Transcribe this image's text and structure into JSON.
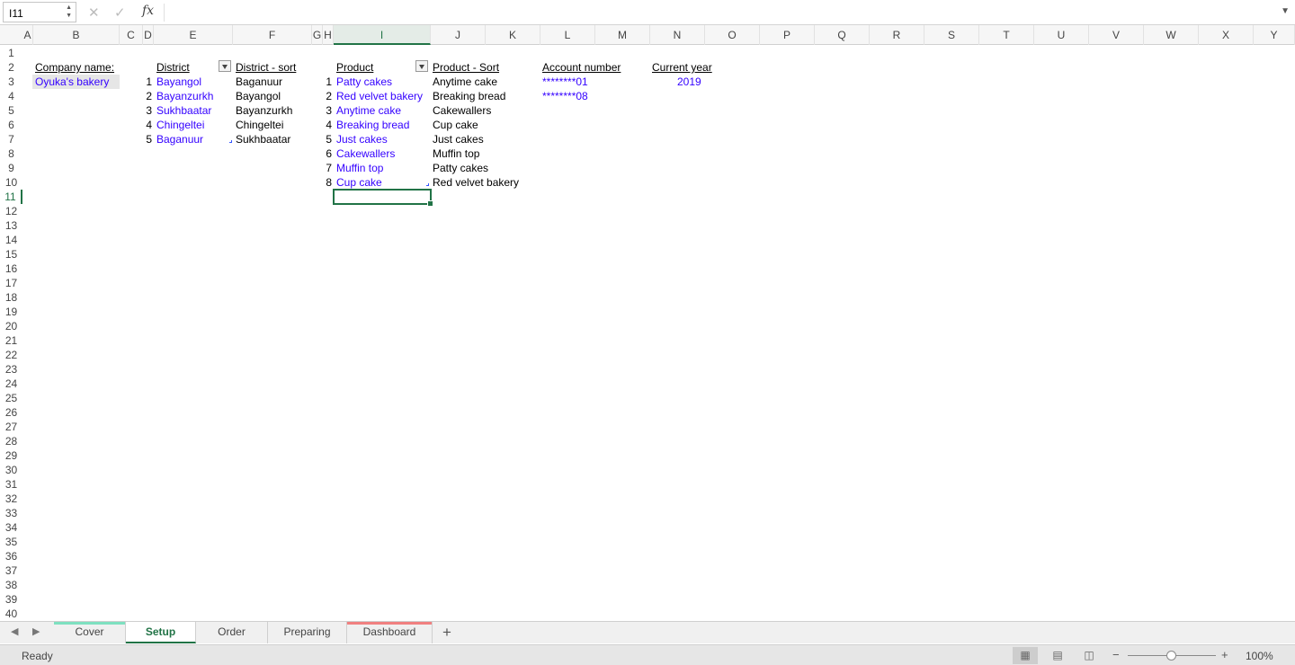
{
  "formula_bar": {
    "name_box": "I11",
    "cancel_icon": "close-icon",
    "enter_icon": "check-icon",
    "fx_label": "fx",
    "formula": ""
  },
  "columns": [
    "A",
    "B",
    "C",
    "D",
    "E",
    "F",
    "G",
    "H",
    "I",
    "J",
    "K",
    "L",
    "M",
    "N",
    "O",
    "P",
    "Q",
    "R",
    "S",
    "T",
    "U",
    "V",
    "W",
    "X",
    "Y"
  ],
  "selected_column": "I",
  "selected_row": "11",
  "rows": [
    "1",
    "2",
    "3",
    "4",
    "5",
    "6",
    "7",
    "8",
    "9",
    "10",
    "11",
    "12",
    "13",
    "14",
    "15",
    "16",
    "17",
    "18",
    "19",
    "20",
    "21",
    "22",
    "23",
    "24",
    "25",
    "26",
    "27",
    "28",
    "29",
    "30",
    "31",
    "32",
    "33",
    "34",
    "35",
    "36",
    "37",
    "38",
    "39",
    "40"
  ],
  "sheet": {
    "company_label": "Company name:",
    "company_name": "Oyuka's bakery",
    "district_header": "District",
    "district_sort_header": "District - sort",
    "product_header": "Product",
    "product_sort_header": "Product - Sort",
    "account_header": "Account number",
    "year_header": "Current year",
    "current_year": "2019",
    "accounts": [
      "********01",
      "********08"
    ],
    "districts": [
      {
        "n": "1",
        "name": "Bayangol",
        "sorted": "Baganuur"
      },
      {
        "n": "2",
        "name": "Bayanzurkh",
        "sorted": "Bayangol"
      },
      {
        "n": "3",
        "name": "Sukhbaatar",
        "sorted": "Bayanzurkh"
      },
      {
        "n": "4",
        "name": "Chingeltei",
        "sorted": "Chingeltei"
      },
      {
        "n": "5",
        "name": "Baganuur",
        "sorted": "Sukhbaatar"
      }
    ],
    "products": [
      {
        "n": "1",
        "name": "Patty cakes",
        "sorted": "Anytime cake"
      },
      {
        "n": "2",
        "name": "Red velvet bakery",
        "sorted": "Breaking bread"
      },
      {
        "n": "3",
        "name": "Anytime cake",
        "sorted": "Cakewallers"
      },
      {
        "n": "4",
        "name": "Breaking bread",
        "sorted": "Cup cake"
      },
      {
        "n": "5",
        "name": "Just cakes",
        "sorted": "Just cakes"
      },
      {
        "n": "6",
        "name": "Cakewallers",
        "sorted": "Muffin top"
      },
      {
        "n": "7",
        "name": "Muffin top",
        "sorted": "Patty cakes"
      },
      {
        "n": "8",
        "name": "Cup cake",
        "sorted": "Red velvet bakery"
      }
    ]
  },
  "tabs": {
    "cover": "Cover",
    "setup": "Setup",
    "order": "Order",
    "preparing": "Preparing",
    "dashboard": "Dashboard",
    "add": "+",
    "colors": {
      "cover": "#7ee0c0",
      "dashboard": "#f08080",
      "active": "#217346"
    }
  },
  "status": {
    "ready": "Ready",
    "zoom": "100%",
    "zoom_minus": "−",
    "zoom_plus": "+"
  }
}
